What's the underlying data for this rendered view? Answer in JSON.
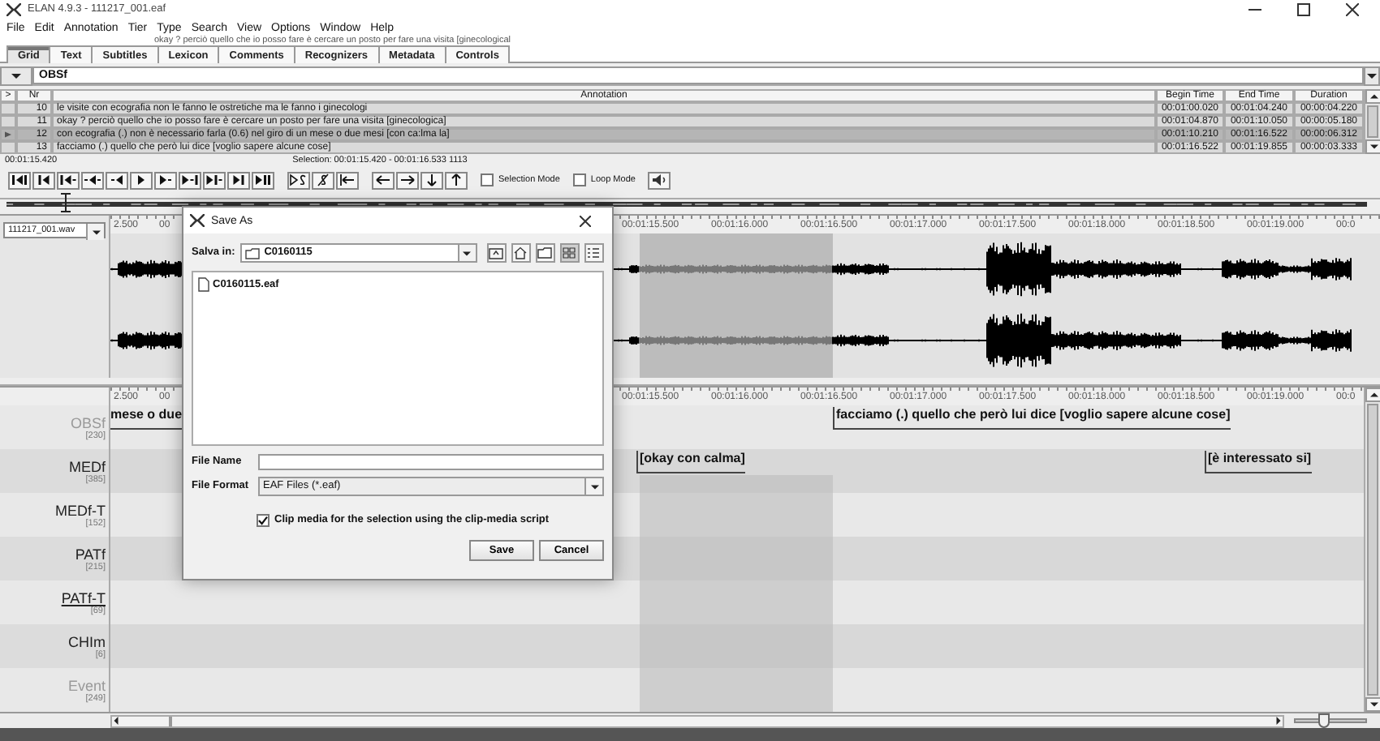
{
  "window": {
    "title": "ELAN 4.9.3 - 111217_001.eaf"
  },
  "menu": [
    "File",
    "Edit",
    "Annotation",
    "Tier",
    "Type",
    "Search",
    "View",
    "Options",
    "Window",
    "Help"
  ],
  "subtitle_overlay": "okay ? perciò quello che io posso fare è cercare un posto per fare una visita [ginecological",
  "tabs": [
    {
      "label": "Grid",
      "selected": true
    },
    {
      "label": "Text",
      "selected": false
    },
    {
      "label": "Subtitles",
      "selected": false
    },
    {
      "label": "Lexicon",
      "selected": false
    },
    {
      "label": "Comments",
      "selected": false
    },
    {
      "label": "Recognizers",
      "selected": false
    },
    {
      "label": "Metadata",
      "selected": false
    },
    {
      "label": "Controls",
      "selected": false
    }
  ],
  "tier_selector": {
    "value": "OBSf"
  },
  "table": {
    "columns": [
      ">",
      "Nr",
      "Annotation",
      "Begin Time",
      "End Time",
      "Duration"
    ],
    "rows": [
      {
        "nr": "10",
        "annotation": "le visite con ecografia non le fanno le ostretiche ma le fanno i ginecologi",
        "begin": "00:01:00.020",
        "end": "00:01:04.240",
        "duration": "00:00:04.220",
        "selected": false
      },
      {
        "nr": "11",
        "annotation": "okay ? perciò quello che io posso fare è cercare un posto per fare una visita [ginecologica]",
        "begin": "00:01:04.870",
        "end": "00:01:10.050",
        "duration": "00:00:05.180",
        "selected": false
      },
      {
        "nr": "12",
        "annotation": "con ecografia (.) non è necessario farla (0.6) nel giro di un mese o due mesi [con ca:lma la]",
        "begin": "00:01:10.210",
        "end": "00:01:16.522",
        "duration": "00:00:06.312",
        "selected": true
      },
      {
        "nr": "13",
        "annotation": "facciamo (.) quello che però lui dice [voglio sapere alcune cose]",
        "begin": "00:01:16.522",
        "end": "00:01:19.855",
        "duration": "00:00:03.333",
        "selected": false
      }
    ]
  },
  "media_player": {
    "time": "00:01:15.420",
    "selection": "Selection: 00:01:15.420 - 00:01:16.533  1113",
    "selection_mode": {
      "label": "Selection Mode",
      "checked": false
    },
    "loop_mode": {
      "label": "Loop Mode",
      "checked": false
    }
  },
  "waveform": {
    "media_file": "111217_001.wav",
    "ruler": [
      "2.500",
      "00",
      "00:01:15.500",
      "00:01:16.000",
      "00:01:16.500",
      "00:01:17.000",
      "00:01:17.500",
      "00:01:18.000",
      "00:01:18.500",
      "00:01:19.000",
      "00:0"
    ]
  },
  "timeline": {
    "ruler": [
      "2.500",
      "00",
      "00:01:15.500",
      "00:01:16.000",
      "00:01:16.500",
      "00:01:17.000",
      "00:01:17.500",
      "00:01:18.000",
      "00:01:18.500",
      "00:01:19.000",
      "00:0"
    ],
    "tiers": [
      {
        "name": "OBSf",
        "count": "[230]",
        "greyed": true,
        "active": false,
        "annotations": [
          "mese o due",
          "facciamo (.) quello che però lui dice [voglio sapere alcune cose]"
        ]
      },
      {
        "name": "MEDf",
        "count": "[385]",
        "greyed": false,
        "active": false,
        "annotations": [
          "[okay con calma]",
          "[è interessato si]"
        ]
      },
      {
        "name": "MEDf-T",
        "count": "[152]",
        "greyed": false,
        "active": false
      },
      {
        "name": "PATf",
        "count": "[215]",
        "greyed": false,
        "active": false
      },
      {
        "name": "PATf-T",
        "count": "[69]",
        "greyed": false,
        "active": true
      },
      {
        "name": "CHIm",
        "count": "[6]",
        "greyed": false,
        "active": false
      },
      {
        "name": "Event",
        "count": "[249]",
        "greyed": true,
        "active": false
      }
    ]
  },
  "zoom_slider": {
    "level": 0.4
  },
  "save_dialog": {
    "title": "Save As",
    "look_in_label": "Salva in:",
    "look_in_value": "C0160115",
    "view_buttons": [
      {
        "kind": "list",
        "selected": true
      },
      {
        "kind": "details",
        "selected": false
      }
    ],
    "files": [
      "C0160115.eaf"
    ],
    "file_name_label": "File Name",
    "file_format": {
      "label": "File Format",
      "value": "EAF Files (*.eaf)"
    },
    "clip_media": {
      "label": "Clip media for the selection using the clip-media script",
      "checked": true
    },
    "buttons": [
      "Save",
      "Cancel"
    ]
  }
}
